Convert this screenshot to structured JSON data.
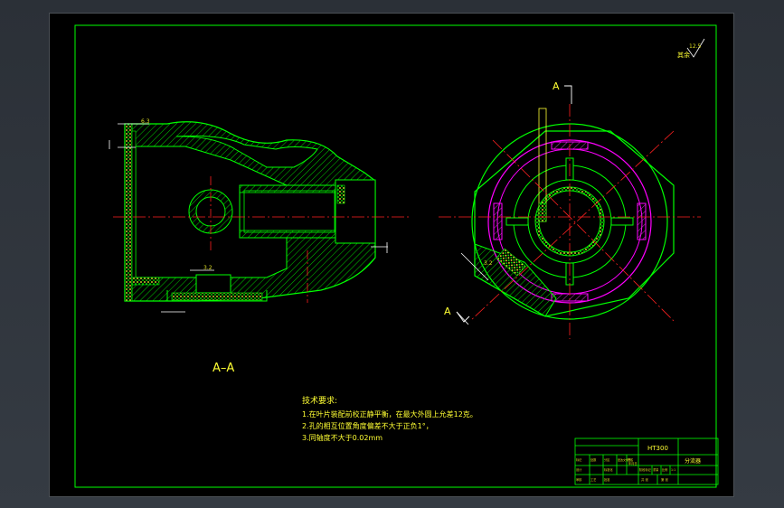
{
  "section_view_label": "A–A",
  "cut_mark_top": "A",
  "cut_mark_bottom": "A",
  "roughness": {
    "value": "12.5",
    "note": "其余"
  },
  "dims": {
    "d1": "6.3",
    "d2": "3.2",
    "d3": "3.2"
  },
  "tech": {
    "title": "技术要求:",
    "items": [
      "1.在叶片装配前校正静平衡，在最大外圆上允差12克。",
      "2.孔的相互位置角度偏差不大于正负1°，",
      "3.同轴度不大于0.02mm"
    ]
  },
  "title_block": {
    "material": "HT300",
    "part_name": "分流器",
    "cells": [
      "标记",
      "处数",
      "分区",
      "更改文件号",
      "签名",
      "年月日",
      "设计",
      "标准化",
      "阶段标记",
      "重量",
      "比例",
      "1:1",
      "审核",
      "工艺",
      "批准",
      "共 张",
      "第 张"
    ]
  },
  "colors": {
    "sheet": "#000000",
    "frame": "#00ff00",
    "centerline": "#ff2020",
    "hatch": "#00cc00",
    "dim": "#ffffff",
    "magenta": "#ff00ff",
    "text": "#ffff33"
  }
}
